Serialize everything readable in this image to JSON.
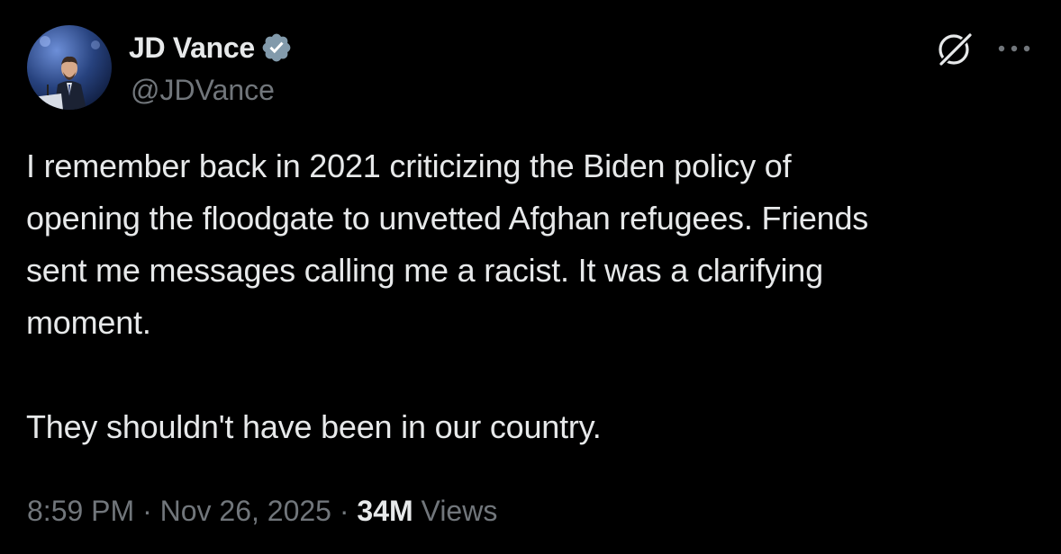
{
  "author": {
    "display_name": "JD Vance",
    "handle": "@JDVance",
    "verified_color": "#829aab"
  },
  "tweet": {
    "text": "I remember back in 2021 criticizing the Biden policy of\nopening the floodgate to unvetted Afghan refugees. Friends\nsent me messages calling me a racist. It was a clarifying\nmoment.\n\nThey shouldn't have been in our country."
  },
  "meta": {
    "time": "8:59 PM",
    "separator": "·",
    "date": "Nov 26, 2025",
    "views_count": "34M",
    "views_label": "Views"
  },
  "icons": {
    "grok": "grok-icon",
    "more": "more-icon",
    "verified": "verified-badge-icon"
  },
  "colors": {
    "background": "#000000",
    "primary_text": "#e7e9ea",
    "secondary_text": "#71767b"
  }
}
